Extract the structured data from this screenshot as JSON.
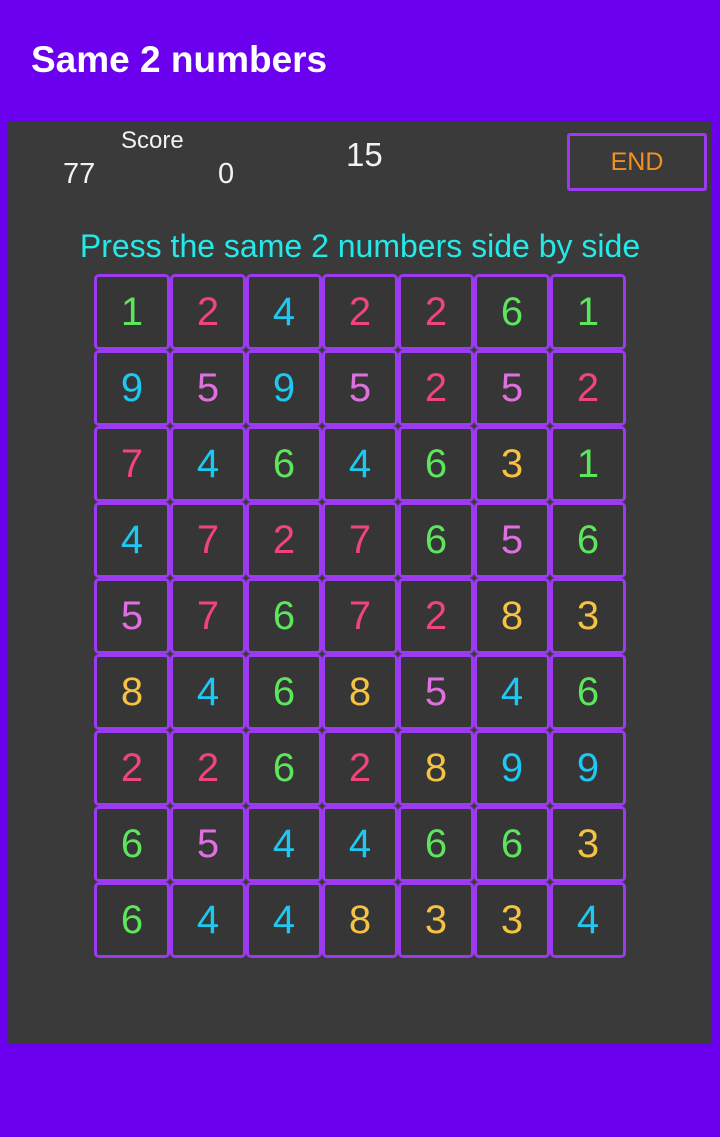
{
  "app": {
    "title": "Same 2 numbers",
    "header_bg": "#6a00ee",
    "panel_bg": "#3a3a3a"
  },
  "status": {
    "lives": "77",
    "score_label": "Score",
    "score_value": "0",
    "timer": "15",
    "end_label": "END",
    "end_text_color": "#f29020",
    "end_border_color": "#9b3af0"
  },
  "instruction": {
    "text": "Press the same 2 numbers side by side",
    "color": "#25e8e8"
  },
  "board": {
    "rows": 9,
    "cols": 7,
    "tile_border_color": "#9b3af0",
    "tile_bg": "#363636",
    "digit_colors": {
      "1": "#5ce65c",
      "2": "#f0447a",
      "3": "#f5c242",
      "4": "#1ec8f0",
      "5": "#e070e0",
      "6": "#5ce65c",
      "7": "#f0447a",
      "8": "#f5c242",
      "9": "#1ec8f0"
    },
    "cells": [
      [
        "1",
        "2",
        "4",
        "2",
        "2",
        "6",
        "1"
      ],
      [
        "9",
        "5",
        "9",
        "5",
        "2",
        "5",
        "2"
      ],
      [
        "7",
        "4",
        "6",
        "4",
        "6",
        "3",
        "1"
      ],
      [
        "4",
        "7",
        "2",
        "7",
        "6",
        "5",
        "6"
      ],
      [
        "5",
        "7",
        "6",
        "7",
        "2",
        "8",
        "3"
      ],
      [
        "8",
        "4",
        "6",
        "8",
        "5",
        "4",
        "6"
      ],
      [
        "2",
        "2",
        "6",
        "2",
        "8",
        "9",
        "9"
      ],
      [
        "6",
        "5",
        "4",
        "4",
        "6",
        "6",
        "3"
      ],
      [
        "6",
        "4",
        "4",
        "8",
        "3",
        "3",
        "4"
      ]
    ]
  }
}
